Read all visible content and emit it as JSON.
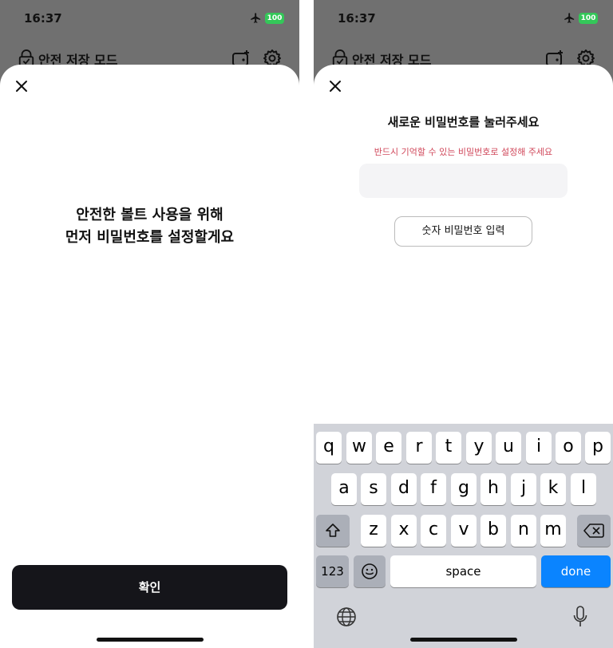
{
  "status": {
    "time": "16:37",
    "battery": "100"
  },
  "header": {
    "title": "안전 저장 모드"
  },
  "intro": {
    "line1": "안전한 볼트 사용을 위해",
    "line2": "먼저 비밀번호를 설정할게요",
    "confirm_label": "확인"
  },
  "password": {
    "title": "새로운 비밀번호를 눌러주세요",
    "hint": "반드시 기억할 수 있는 비밀번호로 설정해 주세요",
    "numeric_label": "숫자 비밀번호 입력"
  },
  "keyboard": {
    "row1": [
      "q",
      "w",
      "e",
      "r",
      "t",
      "y",
      "u",
      "i",
      "o",
      "p"
    ],
    "row2": [
      "a",
      "s",
      "d",
      "f",
      "g",
      "h",
      "j",
      "k",
      "l"
    ],
    "row3": [
      "z",
      "x",
      "c",
      "v",
      "b",
      "n",
      "m"
    ],
    "numbers_label": "123",
    "space_label": "space",
    "done_label": "done"
  },
  "colors": {
    "accent": "#0a84ff",
    "hint": "#d0475a",
    "primary_button": "#15151a",
    "battery": "#34c759"
  }
}
